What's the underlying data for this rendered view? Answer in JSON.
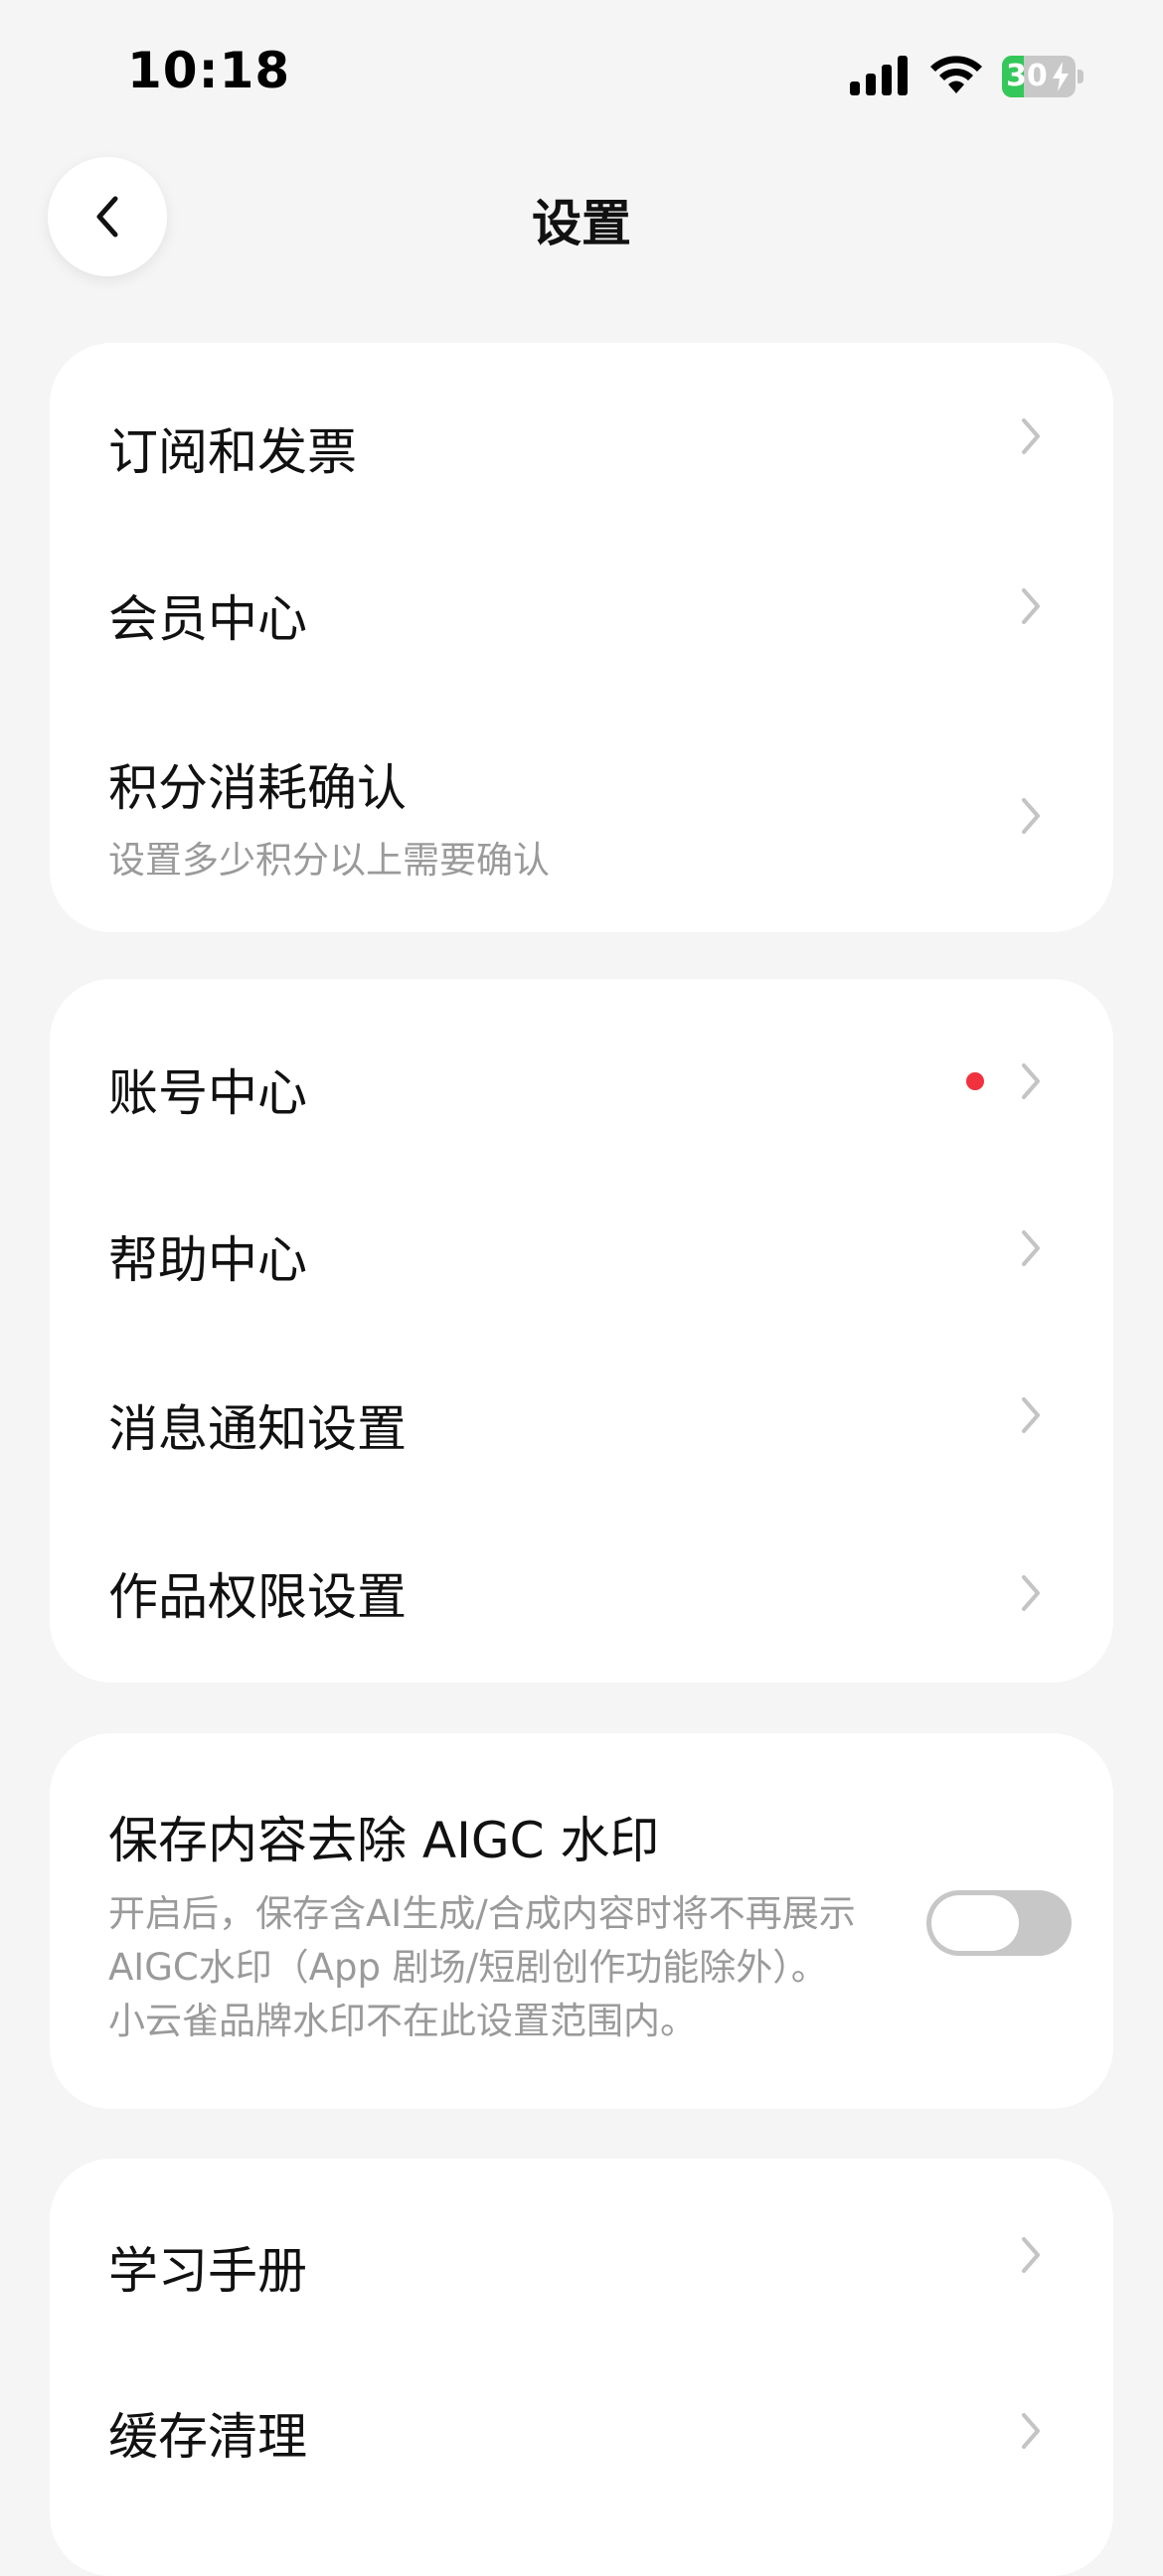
{
  "status_bar": {
    "time": "10:18",
    "battery_level": "30",
    "battery_percent": 30,
    "signal_icon": "cellular-signal-icon",
    "wifi_icon": "wifi-icon",
    "battery_icon": "battery-charging-icon"
  },
  "header": {
    "title": "设置",
    "back_icon": "chevron-left-icon"
  },
  "group1": {
    "subscription": "订阅和发票",
    "membership": "会员中心",
    "points_confirm": "积分消耗确认",
    "points_confirm_sub": "设置多少积分以上需要确认"
  },
  "group2": {
    "account": "账号中心",
    "help": "帮助中心",
    "notifications": "消息通知设置",
    "permissions": "作品权限设置"
  },
  "aigc": {
    "title": "保存内容去除 AIGC 水印",
    "desc_line1": "开启后，保存含AI生成/合成内容时将不再展示",
    "desc_line2": "AIGC水印（App 剧场/短剧创作功能除外）。",
    "desc_line3": "小云雀品牌水印不在此设置范围内。",
    "toggle_on": false
  },
  "group4": {
    "manual": "学习手册",
    "cache": "缓存清理"
  },
  "colors": {
    "background": "#f5f5f5",
    "card": "#ffffff",
    "red_dot": "#f2313e",
    "battery_green": "#34c759",
    "toggle_off": "#c7c7c7"
  }
}
